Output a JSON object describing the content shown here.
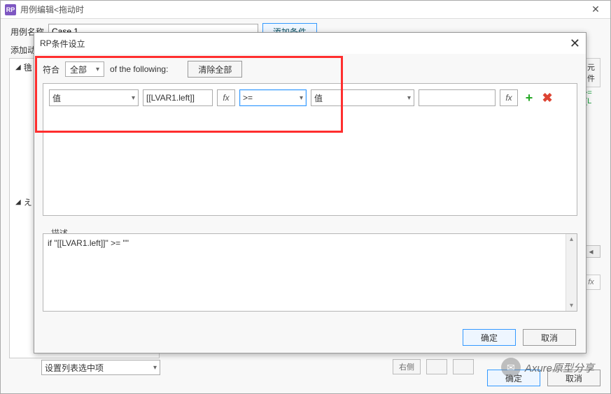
{
  "parent": {
    "title": "用例编辑<拖动时",
    "case_label": "用例名称",
    "case_value": "Case 1",
    "add_condition_btn": "添加条件",
    "add_action_label": "添加动",
    "tree_item_1": "氇",
    "tree_item_2": "え",
    "set_list_label": "设置列表选中项",
    "right_chip": "元件",
    "right_expr": ">= [[L",
    "right_fx": "fx",
    "ghost1": "右侧",
    "ghost2": "",
    "ok": "确定",
    "cancel": "取消"
  },
  "child": {
    "title": "条件设立",
    "match_label": "符合",
    "match_mode": "全部",
    "of_following": "of the following:",
    "clear_all": "清除全部",
    "row": {
      "field1": "值",
      "expr_value": "[[LVAR1.left]]",
      "fx1": "fx",
      "operator": ">=",
      "field3": "值",
      "value_box": "",
      "fx2": "fx"
    },
    "desc_label": "描述",
    "desc_text": "if \"[[LVAR1.left]]\" >= \"\"",
    "ok": "确定",
    "cancel": "取消"
  },
  "watermark": "Axure原型分享"
}
